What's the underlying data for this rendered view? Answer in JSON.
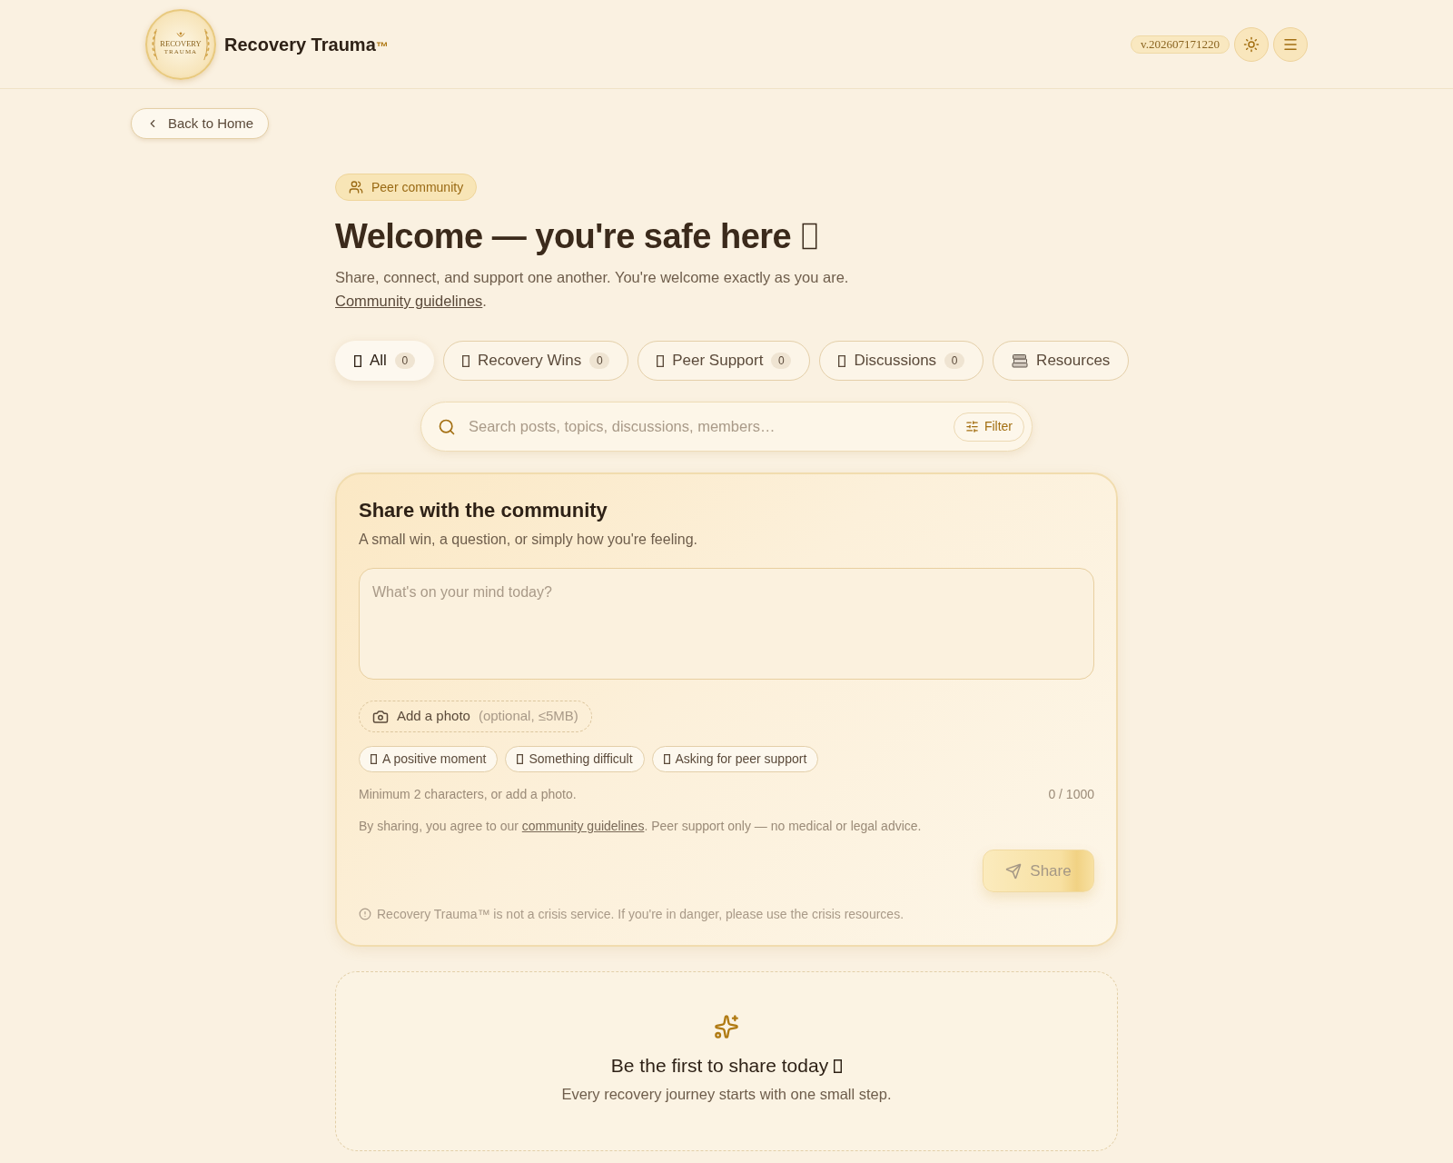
{
  "header": {
    "logo": {
      "text": "RECOVERY",
      "subtext": "TRAUMA"
    },
    "brand": "Recovery Trauma",
    "brand_mark": "™",
    "version": "v.202607171220"
  },
  "back_link": "Back to Home",
  "hero": {
    "badge": "Peer community",
    "title": "Welcome — you're safe here",
    "subtitle": "Share, connect, and support one another. You're welcome exactly as you are.",
    "link": "Community guidelines",
    "after_link": "."
  },
  "tabs": [
    {
      "kind": "filter",
      "label": "All",
      "count": "0",
      "selected": true
    },
    {
      "kind": "filter",
      "label": "Recovery Wins",
      "count": "0",
      "selected": false
    },
    {
      "kind": "filter",
      "label": "Peer Support",
      "count": "0",
      "selected": false
    },
    {
      "kind": "filter",
      "label": "Discussions",
      "count": "0",
      "selected": false
    },
    {
      "kind": "link",
      "label": "Resources",
      "selected": false
    }
  ],
  "search": {
    "placeholder": "Search posts, topics, discussions, members…",
    "filter": "Filter"
  },
  "composer": {
    "title": "Share with the community",
    "subtitle": "A small win, a question, or simply how you're feeling.",
    "placeholder": "What's on your mind today?",
    "photo": {
      "label": "Add a photo",
      "hint": "(optional, ≤5MB)"
    },
    "prompts": [
      "A positive moment",
      "Something difficult",
      "Asking for peer support"
    ],
    "hint": "Minimum 2 characters, or add a photo.",
    "counter": "0 / 1000",
    "terms": {
      "before": "By sharing, you agree to our ",
      "link": "community guidelines",
      "after": ". Peer support only — no medical or legal advice."
    },
    "share": {
      "label": "Share",
      "disabled": true
    },
    "disclaimer": "Recovery Trauma™ is not a crisis service. If you're in danger, please use the crisis resources."
  },
  "empty_state": {
    "title": "Be the first to share today",
    "text": "Every recovery journey starts with one small step."
  }
}
